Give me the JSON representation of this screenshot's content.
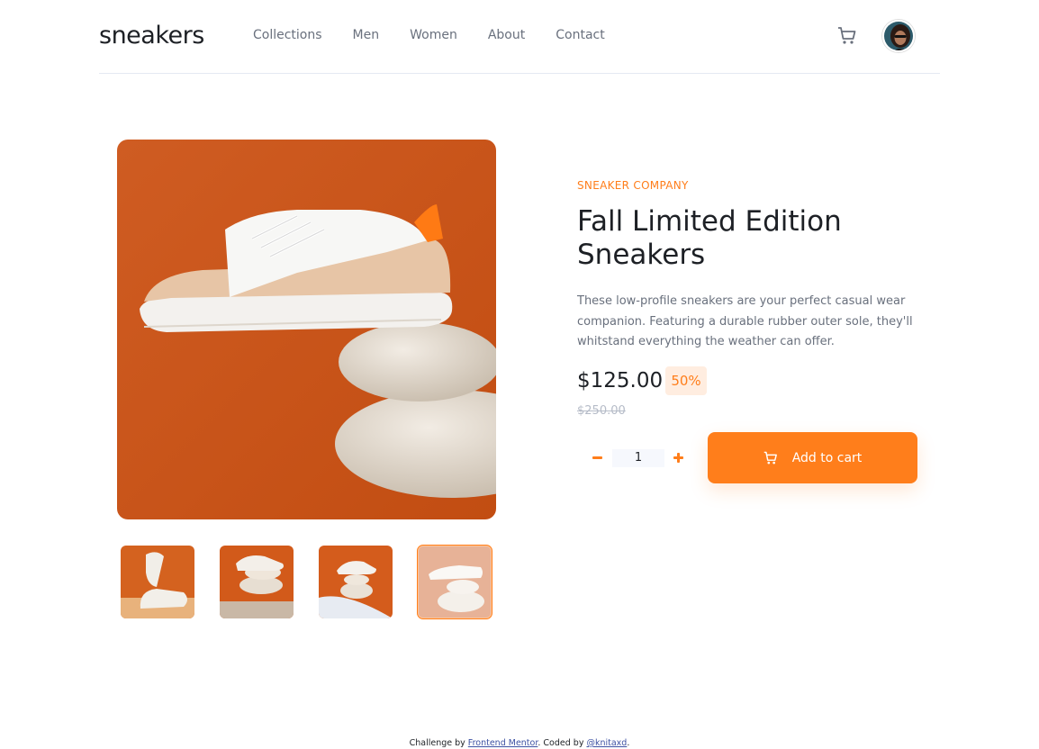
{
  "header": {
    "logo": "sneakers",
    "nav": [
      "Collections",
      "Men",
      "Women",
      "About",
      "Contact"
    ],
    "cart_icon": "cart-icon",
    "avatar_icon": "user-avatar"
  },
  "gallery": {
    "main_alt": "sneaker on stacked stones",
    "thumbnails": [
      "thumbnail-1",
      "thumbnail-2",
      "thumbnail-3",
      "thumbnail-4"
    ],
    "active_index": 3
  },
  "product": {
    "company": "SNEAKER COMPANY",
    "title": "Fall Limited Edition Sneakers",
    "description": "These low-profile sneakers are your perfect casual wear companion. Featuring a durable rubber outer sole, they'll whitstand everything the weather can offer.",
    "price": "$125.00",
    "discount": "50%",
    "old_price": "$250.00",
    "quantity": "1",
    "add_to_cart": "Add to cart"
  },
  "footer": {
    "challenge_prefix": "Challenge by ",
    "challenge_link": "Frontend Mentor",
    "coded_prefix": ". Coded by ",
    "author_link": "@knitaxd",
    "suffix": "."
  },
  "colors": {
    "accent": "#ff7e1b",
    "accent_light": "#ffede0",
    "text_dark": "#1d2025",
    "text_muted": "#69707d",
    "background_orange": "#c9541a"
  }
}
